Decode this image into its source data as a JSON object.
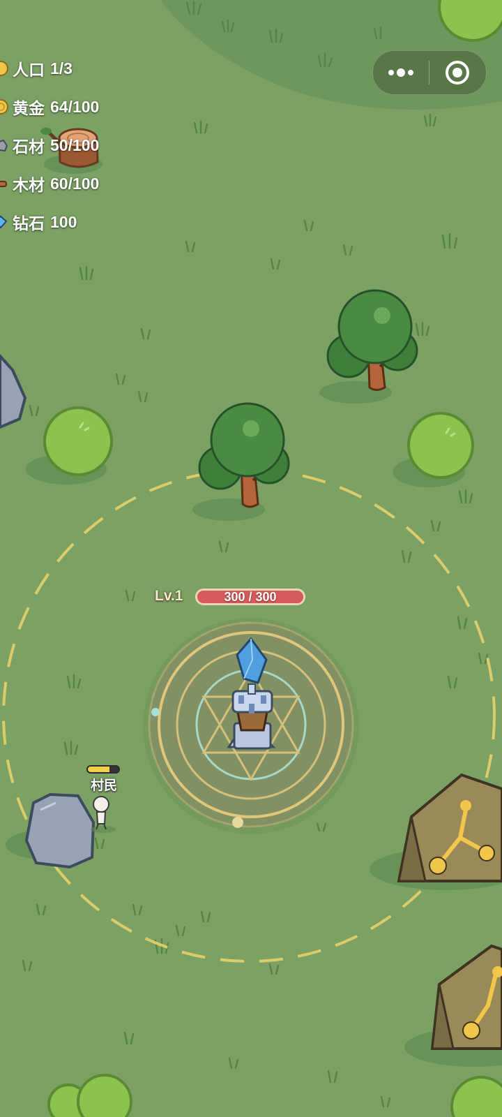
{
  "resources": [
    {
      "label": "人口",
      "value": "1/3",
      "icon": "population-icon",
      "color": "#f2c64a"
    },
    {
      "label": "黄金",
      "value": "64/100",
      "icon": "gold-coin-icon",
      "color": "#f2c64a"
    },
    {
      "label": "石材",
      "value": "50/100",
      "icon": "stone-icon",
      "color": "#9aa0a8"
    },
    {
      "label": "木材",
      "value": "60/100",
      "icon": "wood-icon",
      "color": "#b5653b"
    },
    {
      "label": "钻石",
      "value": "100",
      "icon": "diamond-icon",
      "color": "#5fb6f0"
    }
  ],
  "capsule": {
    "more_icon": "more-dots-icon",
    "close_icon": "close-target-icon"
  },
  "tower": {
    "level": "Lv.1",
    "hp_text": "300 / 300",
    "hp_fraction": 1.0,
    "hp_color": "#d65b5b"
  },
  "villager": {
    "name": "村民",
    "energy_fraction": 0.7,
    "energy_color": "#f2d14a"
  },
  "colors": {
    "grass": "#7ba164",
    "range_ring": "#e8d06a",
    "tree_dark": "#3f7f3a",
    "bush": "#8cc24e",
    "rock": "#98a2b4",
    "gold_ore": "#f2c64a"
  }
}
